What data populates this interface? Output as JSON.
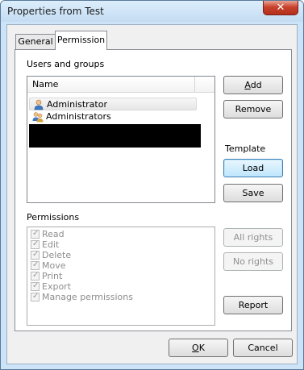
{
  "window": {
    "title": "Properties from Test",
    "close_glyph": "✕"
  },
  "tabs": [
    {
      "label": "General",
      "active": false
    },
    {
      "label": "Permission",
      "active": true
    }
  ],
  "users_groups": {
    "group_label": "Users and groups",
    "column_header": "Name",
    "items": [
      {
        "label": "Administrator",
        "icon": "user-icon",
        "selected": true
      },
      {
        "label": "Administrators",
        "icon": "group-icon",
        "selected": false
      }
    ]
  },
  "buttons": {
    "add_prefix": "",
    "add_mnemonic": "A",
    "add_rest": "dd",
    "remove": "Remove",
    "template_label": "Template",
    "load": "Load",
    "save": "Save",
    "all_rights": "All rights",
    "no_rights": "No rights",
    "report": "Report",
    "ok_mnemonic": "O",
    "ok_rest": "K",
    "cancel": "Cancel"
  },
  "permissions": {
    "group_label": "Permissions",
    "items": [
      {
        "label": "Read",
        "checked": true
      },
      {
        "label": "Edit",
        "checked": true
      },
      {
        "label": "Delete",
        "checked": true
      },
      {
        "label": "Move",
        "checked": true
      },
      {
        "label": "Print",
        "checked": true
      },
      {
        "label": "Export",
        "checked": true
      },
      {
        "label": "Manage permissions",
        "checked": true
      }
    ]
  },
  "colors": {
    "title_bar": "#c4dcf2",
    "close_button": "#c8432d",
    "default_button": "#bee6fd",
    "redaction": "#000000"
  }
}
